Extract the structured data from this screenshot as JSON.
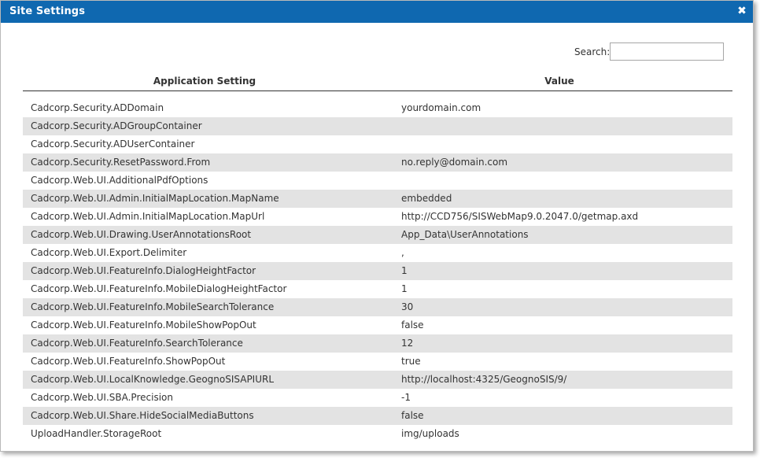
{
  "dialog": {
    "title": "Site Settings",
    "close_glyph": "✖"
  },
  "search": {
    "label": "Search:",
    "value": ""
  },
  "table": {
    "headers": {
      "setting": "Application Setting",
      "value": "Value"
    },
    "rows": [
      {
        "setting": "Cadcorp.Security.ADDomain",
        "value": "yourdomain.com"
      },
      {
        "setting": "Cadcorp.Security.ADGroupContainer",
        "value": ""
      },
      {
        "setting": "Cadcorp.Security.ADUserContainer",
        "value": ""
      },
      {
        "setting": "Cadcorp.Security.ResetPassword.From",
        "value": "no.reply@domain.com"
      },
      {
        "setting": "Cadcorp.Web.UI.AdditionalPdfOptions",
        "value": ""
      },
      {
        "setting": "Cadcorp.Web.UI.Admin.InitialMapLocation.MapName",
        "value": "embedded"
      },
      {
        "setting": "Cadcorp.Web.UI.Admin.InitialMapLocation.MapUrl",
        "value": "http://CCD756/SISWebMap9.0.2047.0/getmap.axd"
      },
      {
        "setting": "Cadcorp.Web.UI.Drawing.UserAnnotationsRoot",
        "value": "App_Data\\UserAnnotations"
      },
      {
        "setting": "Cadcorp.Web.UI.Export.Delimiter",
        "value": ","
      },
      {
        "setting": "Cadcorp.Web.UI.FeatureInfo.DialogHeightFactor",
        "value": "1"
      },
      {
        "setting": "Cadcorp.Web.UI.FeatureInfo.MobileDialogHeightFactor",
        "value": "1"
      },
      {
        "setting": "Cadcorp.Web.UI.FeatureInfo.MobileSearchTolerance",
        "value": "30"
      },
      {
        "setting": "Cadcorp.Web.UI.FeatureInfo.MobileShowPopOut",
        "value": "false"
      },
      {
        "setting": "Cadcorp.Web.UI.FeatureInfo.SearchTolerance",
        "value": "12"
      },
      {
        "setting": "Cadcorp.Web.UI.FeatureInfo.ShowPopOut",
        "value": "true"
      },
      {
        "setting": "Cadcorp.Web.UI.LocalKnowledge.GeognoSISAPIURL",
        "value": "http://localhost:4325/GeognoSIS/9/"
      },
      {
        "setting": "Cadcorp.Web.UI.SBA.Precision",
        "value": "-1"
      },
      {
        "setting": "Cadcorp.Web.UI.Share.HideSocialMediaButtons",
        "value": "false"
      },
      {
        "setting": "UploadHandler.StorageRoot",
        "value": "img/uploads"
      }
    ]
  },
  "colors": {
    "titlebar": "#0f68b0",
    "stripe": "#e3e3e3",
    "text": "#333333"
  },
  "icons": {
    "close": "close-icon"
  }
}
